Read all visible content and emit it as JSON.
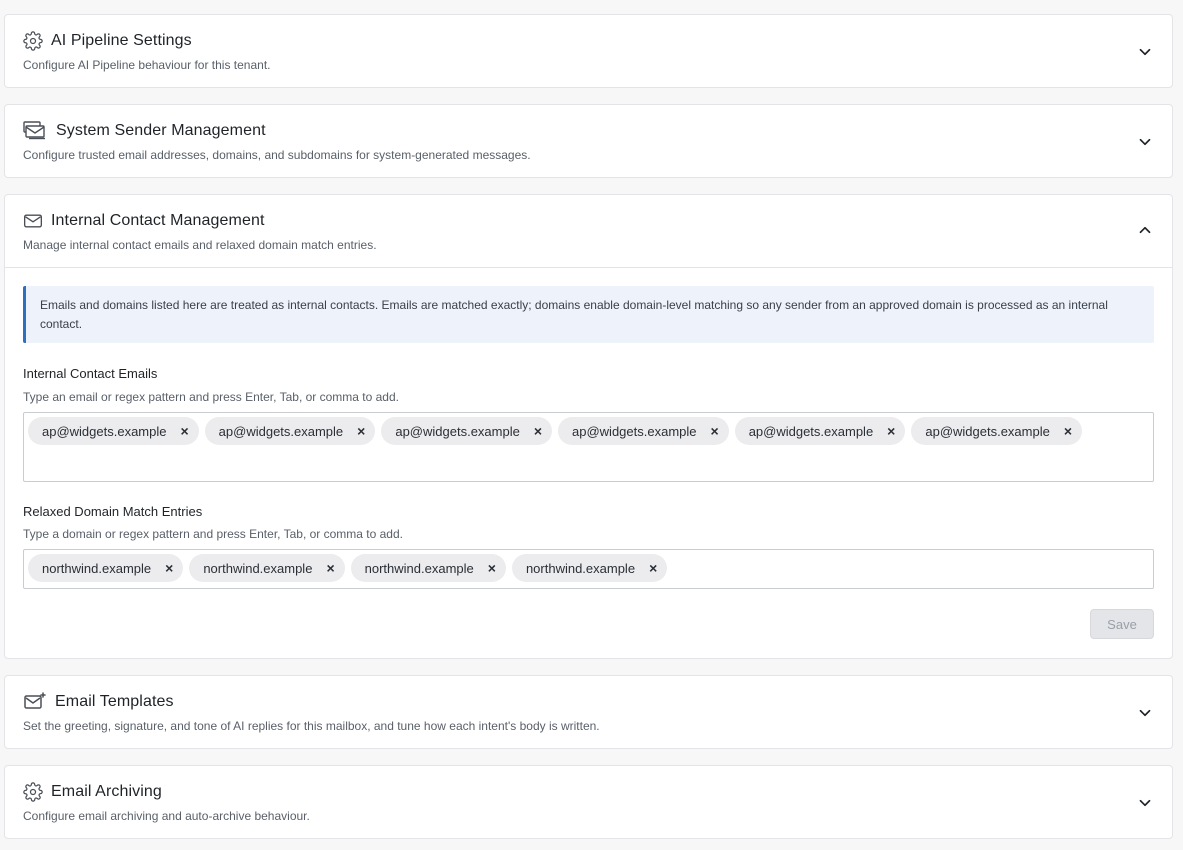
{
  "panels": [
    {
      "title": "AI Pipeline Settings",
      "description": "Configure AI Pipeline behaviour for this tenant.",
      "icon": "gear-icon",
      "expanded": false
    },
    {
      "title": "System Sender Management",
      "description": "Configure trusted email addresses, domains, and subdomains for system-generated messages.",
      "icon": "mail-stack-icon",
      "expanded": false
    },
    {
      "title": "Internal Contact Management",
      "description": "Manage internal contact emails and relaxed domain match entries.",
      "icon": "envelope-icon",
      "expanded": true
    },
    {
      "title": "Email Templates",
      "description": "Set the greeting, signature, and tone of AI replies for this mailbox, and tune how each intent's body is written.",
      "icon": "mail-template-icon",
      "expanded": false
    },
    {
      "title": "Email Archiving",
      "description": "Configure email archiving and auto-archive behaviour.",
      "icon": "gear-icon",
      "expanded": false
    }
  ],
  "internal_contacts": {
    "info_text": "Emails and domains listed here are treated as internal contacts. Emails are matched exactly; domains enable domain-level matching so any sender from an approved domain is processed as an internal contact.",
    "emails": {
      "label": "Internal Contact Emails",
      "help": "Type an email or regex pattern and press Enter, Tab, or comma to add.",
      "tags": [
        "ap@widgets.example",
        "ap@widgets.example",
        "ap@widgets.example",
        "ap@widgets.example",
        "ap@widgets.example",
        "ap@widgets.example"
      ]
    },
    "domains": {
      "label": "Relaxed Domain Match Entries",
      "help": "Type a domain or regex pattern and press Enter, Tab, or comma to add.",
      "tags": [
        "northwind.example",
        "northwind.example",
        "northwind.example",
        "northwind.example"
      ]
    },
    "save_label": "Save",
    "save_disabled": true
  },
  "colors": {
    "accent": "#2f6fbf",
    "info_bg": "#eef2fb",
    "chip_bg": "#ececee"
  }
}
